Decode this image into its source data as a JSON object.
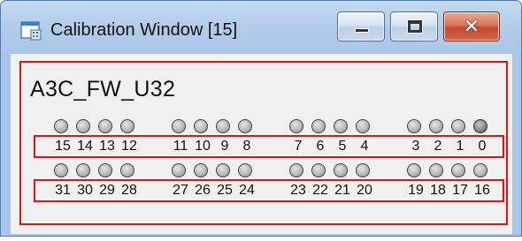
{
  "window": {
    "title": "Calibration Window [15]",
    "icon": "app-window-icon"
  },
  "caption_buttons": {
    "minimize_icon": "minimize-icon",
    "maximize_icon": "maximize-icon",
    "close_glyph": "✕"
  },
  "device": {
    "label": "A3C_FW_U32"
  },
  "bit_rows": [
    {
      "bits": [
        "15",
        "14",
        "13",
        "12",
        "11",
        "10",
        "9",
        "8",
        "7",
        "6",
        "5",
        "4",
        "3",
        "2",
        "1",
        "0"
      ],
      "states": [
        0,
        0,
        0,
        0,
        0,
        0,
        0,
        0,
        0,
        0,
        0,
        0,
        0,
        0,
        0,
        1
      ]
    },
    {
      "bits": [
        "31",
        "30",
        "29",
        "28",
        "27",
        "26",
        "25",
        "24",
        "23",
        "22",
        "21",
        "20",
        "19",
        "18",
        "17",
        "16"
      ],
      "states": [
        0,
        0,
        0,
        0,
        0,
        0,
        0,
        0,
        0,
        0,
        0,
        0,
        0,
        0,
        0,
        0
      ]
    }
  ],
  "colors": {
    "highlight_box": "#e01414",
    "led_off": "#b8b8b8",
    "led_on": "#8a8a8a"
  }
}
